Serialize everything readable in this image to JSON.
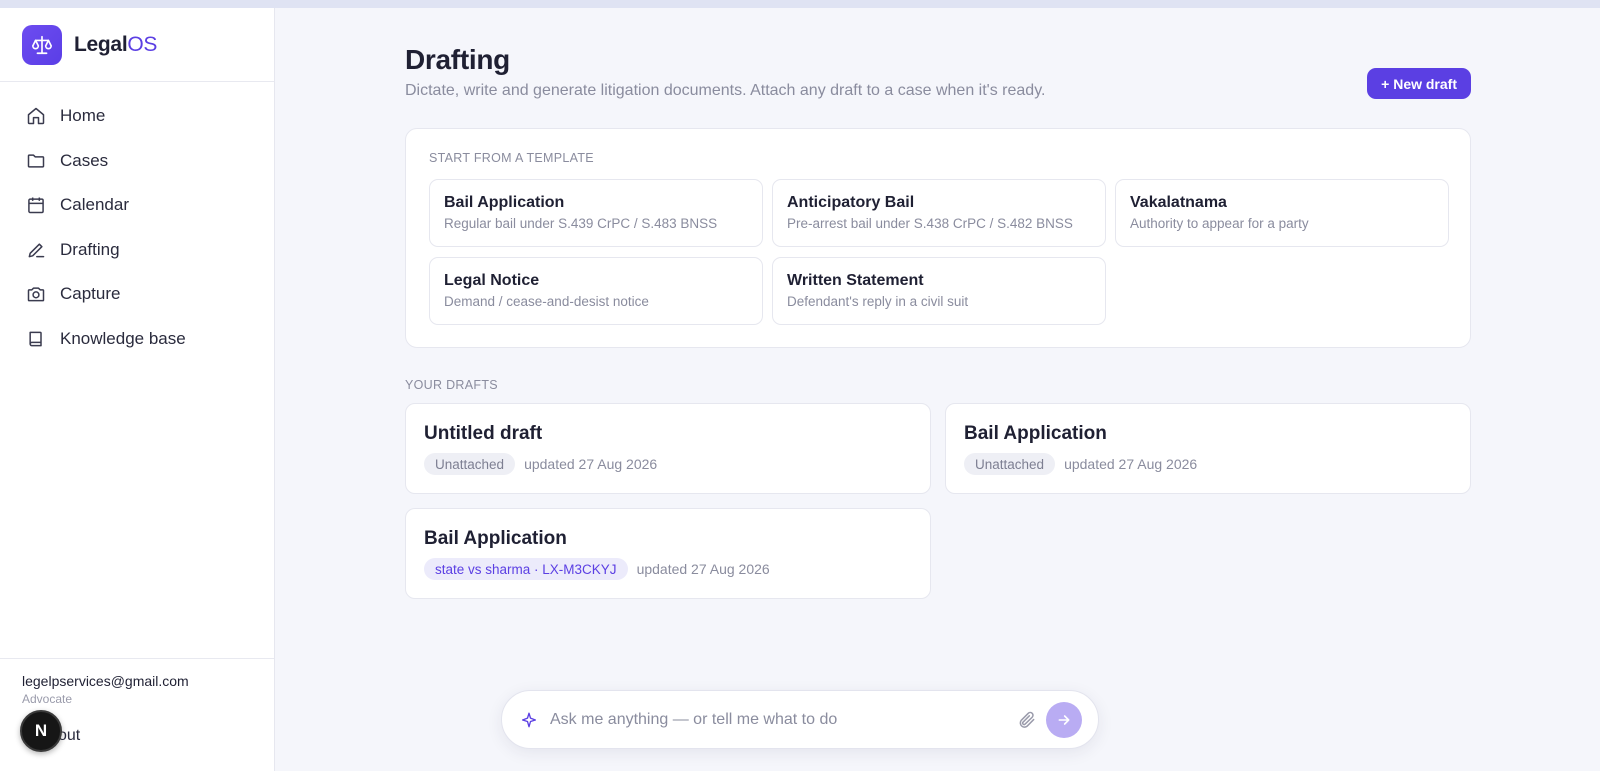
{
  "brand": {
    "name_main": "Legal",
    "name_accent": "OS",
    "logo_icon": "scale-icon"
  },
  "sidebar": {
    "items": [
      {
        "label": "Home",
        "icon": "home-icon"
      },
      {
        "label": "Cases",
        "icon": "folder-icon"
      },
      {
        "label": "Calendar",
        "icon": "calendar-icon"
      },
      {
        "label": "Drafting",
        "icon": "pen-icon"
      },
      {
        "label": "Capture",
        "icon": "camera-icon"
      },
      {
        "label": "Knowledge base",
        "icon": "book-icon"
      }
    ],
    "user": {
      "email": "legelpservices@gmail.com",
      "role": "Advocate"
    },
    "signout_label": "out",
    "dev_badge": "N"
  },
  "page": {
    "title": "Drafting",
    "subtitle": "Dictate, write and generate litigation documents. Attach any draft to a case when it's ready.",
    "new_draft_label": "+ New draft"
  },
  "templates": {
    "label": "START FROM A TEMPLATE",
    "items": [
      {
        "title": "Bail Application",
        "desc": "Regular bail under S.439 CrPC / S.483 BNSS"
      },
      {
        "title": "Anticipatory Bail",
        "desc": "Pre-arrest bail under S.438 CrPC / S.482 BNSS"
      },
      {
        "title": "Vakalatnama",
        "desc": "Authority to appear for a party"
      },
      {
        "title": "Legal Notice",
        "desc": "Demand / cease-and-desist notice"
      },
      {
        "title": "Written Statement",
        "desc": "Defendant's reply in a civil suit"
      }
    ]
  },
  "drafts": {
    "label": "YOUR DRAFTS",
    "items": [
      {
        "title": "Untitled draft",
        "tag": "Unattached",
        "updated": "updated 27 Aug 2026"
      },
      {
        "title": "Bail Application",
        "tag": "Unattached",
        "updated": "updated 27 Aug 2026"
      },
      {
        "title": "Bail Application",
        "tag": "state vs sharma · LX-M3CKYJ",
        "updated": "updated 27 Aug 2026"
      }
    ]
  },
  "ask": {
    "placeholder": "Ask me anything — or tell me what to do"
  },
  "colors": {
    "accent": "#5b3fe3",
    "send_button": "#b9acf3"
  }
}
